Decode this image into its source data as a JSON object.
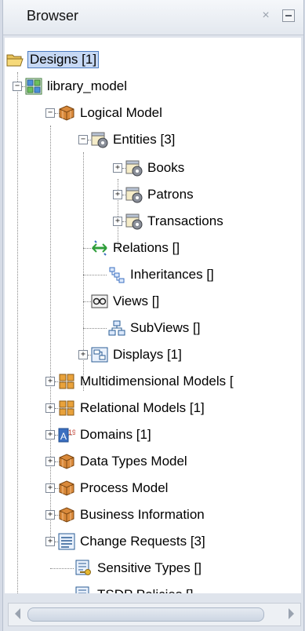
{
  "panel": {
    "title": "Browser",
    "close_glyph": "×",
    "minimize_label": ""
  },
  "tree": {
    "designs": "Designs [1]",
    "library_model": "library_model",
    "logical_model": "Logical Model",
    "entities": "Entities [3]",
    "books": "Books",
    "patrons": "Patrons",
    "transactions": "Transactions",
    "relations": "Relations []",
    "inheritances": "Inheritances []",
    "views": "Views []",
    "subviews": "SubViews []",
    "displays": "Displays [1]",
    "multidimensional": "Multidimensional Models [",
    "relational": "Relational Models [1]",
    "domains": "Domains [1]",
    "data_types": "Data Types Model",
    "process": "Process Model",
    "business": "Business Information",
    "change_requests": "Change Requests [3]",
    "sensitive": "Sensitive Types []",
    "tsdp": "TSDP Policies []"
  },
  "toggles": {
    "expanded": "−",
    "collapsed": "+"
  }
}
